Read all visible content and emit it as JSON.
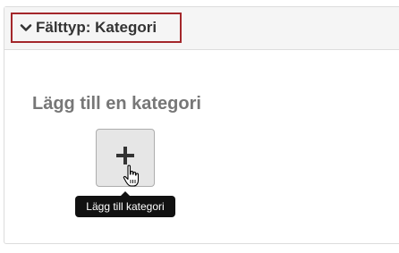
{
  "header": {
    "title": "Fälttyp: Kategori",
    "toggle_icon": "chevron-down-icon",
    "highlight_color": "#a3262a"
  },
  "main": {
    "section_title": "Lägg till en kategori",
    "add_button": {
      "icon": "plus-icon"
    },
    "tooltip": {
      "text": "Lägg till kategori"
    },
    "cursor": "hand-pointer-icon"
  }
}
